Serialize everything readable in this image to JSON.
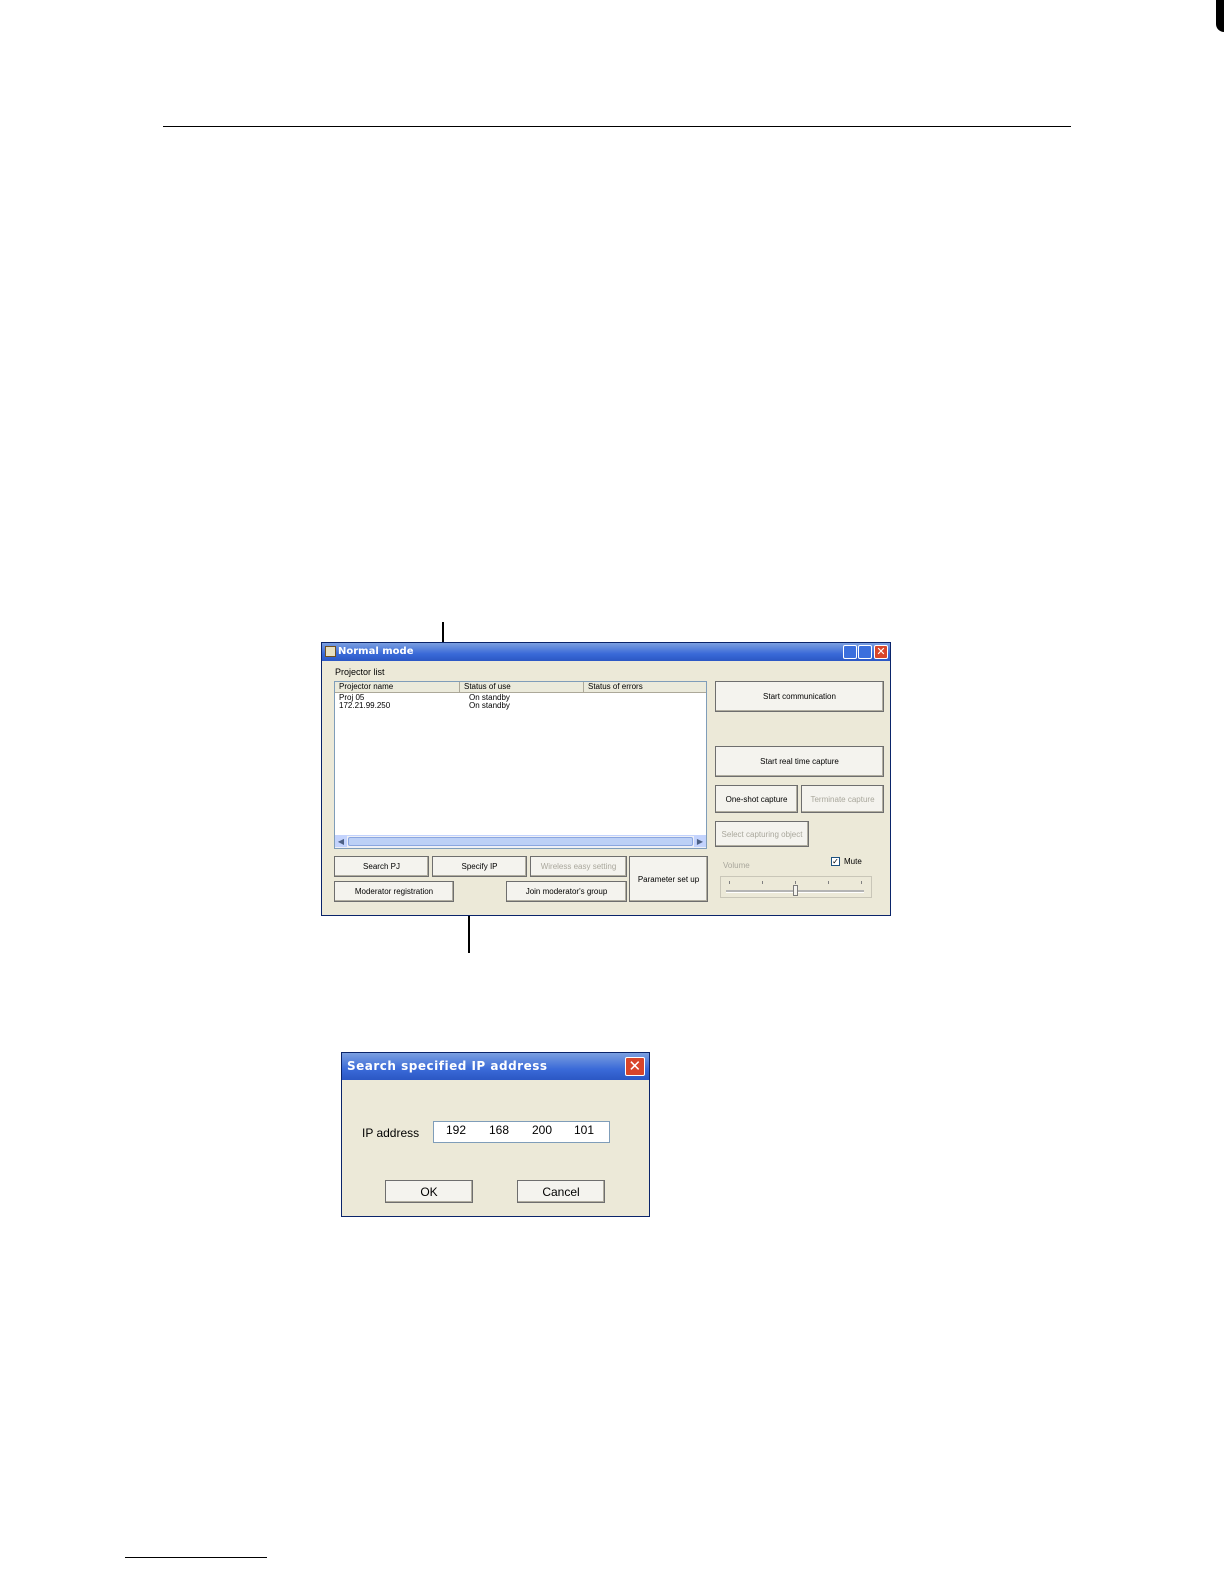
{
  "main_window": {
    "title": "Normal mode",
    "projector_list_label": "Projector list",
    "columns": [
      "Projector name",
      "Status of use",
      "Status of errors"
    ],
    "rows": [
      {
        "name": "Proj 05",
        "status": "On standby",
        "errors": ""
      },
      {
        "name": "172.21.99.250",
        "status": "On standby",
        "errors": ""
      }
    ],
    "buttons": {
      "start_communication": "Start communication",
      "start_realtime_capture": "Start real time capture",
      "one_shot_capture": "One-shot capture",
      "terminate_capture": "Terminate capture",
      "select_capturing_object": "Select capturing object",
      "search_pj": "Search PJ",
      "specify_ip": "Specify IP",
      "wireless_easy_setting": "Wireless easy setting",
      "parameter_set_up": "Parameter set up",
      "moderator_registration": "Moderator registration",
      "join_moderators_group": "Join moderator's group"
    },
    "volume_label": "Volume",
    "mute_label": "Mute",
    "mute_checked": true,
    "volume_level": 0.5
  },
  "ip_dialog": {
    "title": "Search specified IP address",
    "ip_label": "IP address",
    "ip_octets": [
      "192",
      "168",
      "200",
      "101"
    ],
    "ok_label": "OK",
    "cancel_label": "Cancel"
  }
}
